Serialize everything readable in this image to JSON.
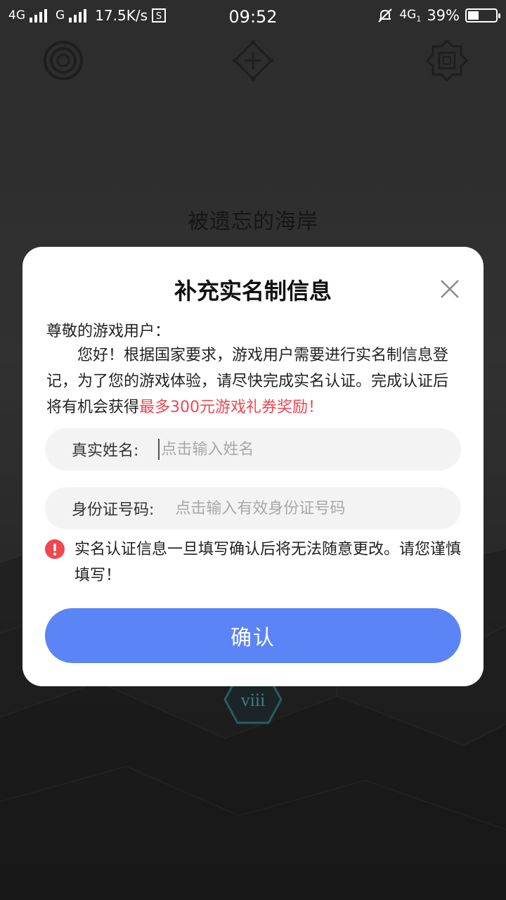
{
  "status_bar": {
    "network1": "4G",
    "network2": "G",
    "speed": "17.5K/s",
    "time": "09:52",
    "network3": "4G",
    "network3_sub": "1",
    "battery": "39%",
    "battery_level": 0.39
  },
  "background": {
    "title": "被遗忘的海岸",
    "chapter_badge": "viii"
  },
  "modal": {
    "title": "补充实名制信息",
    "greeting": "尊敬的游戏用户：",
    "body_main": "您好！根据国家要求，游戏用户需要进行实名制信息登记，为了您的游戏体验，请尽快完成实名认证。完成认证后将有机会获得",
    "body_highlight": "最多300元游戏礼券奖励！",
    "name_field": {
      "label": "真实姓名:",
      "placeholder": "点击输入姓名"
    },
    "id_field": {
      "label": "身份证号码:",
      "placeholder": "点击输入有效身份证号码"
    },
    "warning": "实名认证信息一旦填写确认后将无法随意更改。请您谨慎填写！",
    "confirm_label": "确认"
  },
  "colors": {
    "accent": "#5b84f7",
    "highlight": "#f0474f",
    "warning_icon": "#f0474f"
  }
}
